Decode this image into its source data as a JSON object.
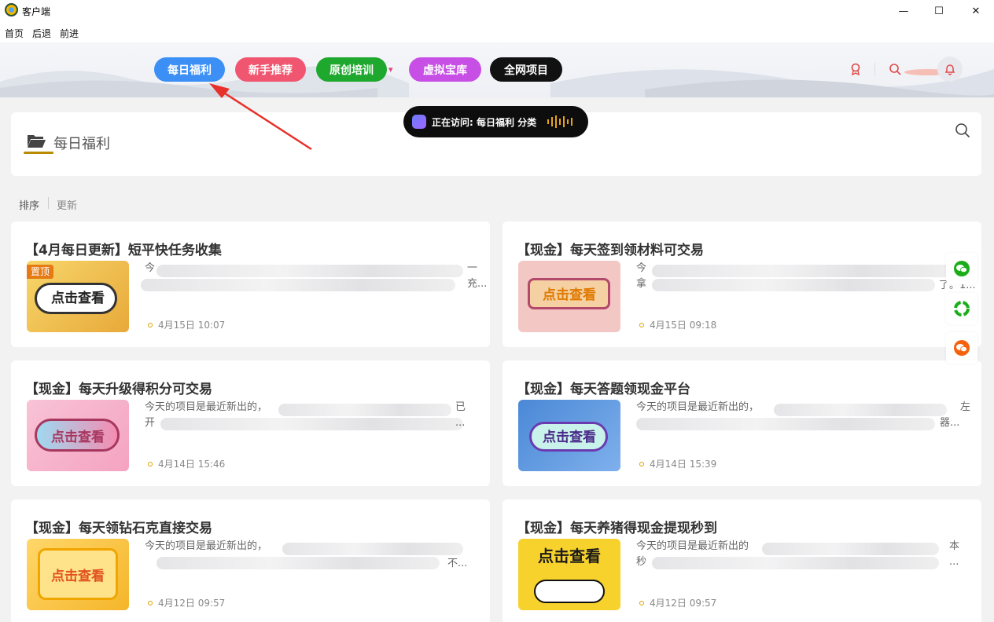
{
  "window": {
    "title": "客户端",
    "minimize": "—",
    "maximize": "☐",
    "close": "✕"
  },
  "menu": {
    "items": [
      "首页",
      "后退",
      "前进"
    ]
  },
  "nav": {
    "tabs": [
      {
        "label": "每日福利",
        "color": "#3b8ff5"
      },
      {
        "label": "新手推荐",
        "color": "#f0566f"
      },
      {
        "label": "原创培训",
        "color": "#1fa82e"
      },
      {
        "label": "虚拟宝库",
        "color": "#c84fe6"
      },
      {
        "label": "全网项目",
        "color": "#111111"
      }
    ],
    "dropdown_icon": "chevron-down-icon",
    "header_icons": [
      "medal-icon",
      "search-icon",
      "bell-icon"
    ]
  },
  "visiting": {
    "text": "正在访问: 每日福利 分类"
  },
  "category": {
    "title": "每日福利",
    "folder_icon": "folder-open-icon",
    "search_icon": "search-icon",
    "accent": "#b88a00"
  },
  "sort": {
    "label": "排序",
    "option": "更新"
  },
  "cards": [
    {
      "title": "【4月每日更新】短平快任务收集",
      "desc_line1": "今",
      "desc_line2": "",
      "desc_end1": "一",
      "desc_end2": "充...",
      "date": "4月15日 10:07",
      "thumb_label": "点击查看",
      "badge": "置顶"
    },
    {
      "title": "【现金】每天签到领材料可交易",
      "desc_line1": "今",
      "desc_line2": "拿",
      "desc_end1": "",
      "desc_end2": "了。1...",
      "date": "4月15日 09:18",
      "thumb_label": "点击查看",
      "badge": ""
    },
    {
      "title": "【现金】每天升级得积分可交易",
      "desc_line1": "今天的项目是最近新出的，",
      "desc_line2": "开",
      "desc_end1": "已",
      "desc_end2": "...",
      "date": "4月14日 15:46",
      "thumb_label": "点击查看",
      "badge": ""
    },
    {
      "title": "【现金】每天答题领现金平台",
      "desc_line1": "今天的项目是最近新出的，",
      "desc_line2": "",
      "desc_end1": "左",
      "desc_end2": "器...",
      "date": "4月14日 15:39",
      "thumb_label": "点击查看",
      "badge": ""
    },
    {
      "title": "【现金】每天领钻石克直接交易",
      "desc_line1": "今天的项目是最近新出的，",
      "desc_line2": "",
      "desc_end1": "",
      "desc_end2": "不...",
      "date": "4月12日 09:57",
      "thumb_label": "点击查看",
      "badge": ""
    },
    {
      "title": "【现金】每天养猪得现金提现秒到",
      "desc_line1": "今天的项目是最近新出的",
      "desc_line2": "秒",
      "desc_end1": "本",
      "desc_end2": "...",
      "date": "4月12日 09:57",
      "thumb_label": "点击查看",
      "badge": ""
    }
  ],
  "side_buttons": [
    {
      "icon": "wechat-icon",
      "color": "#1aad19"
    },
    {
      "icon": "moments-icon",
      "color": "#1aad19"
    },
    {
      "icon": "chat-icon",
      "color": "#f5620f"
    }
  ]
}
